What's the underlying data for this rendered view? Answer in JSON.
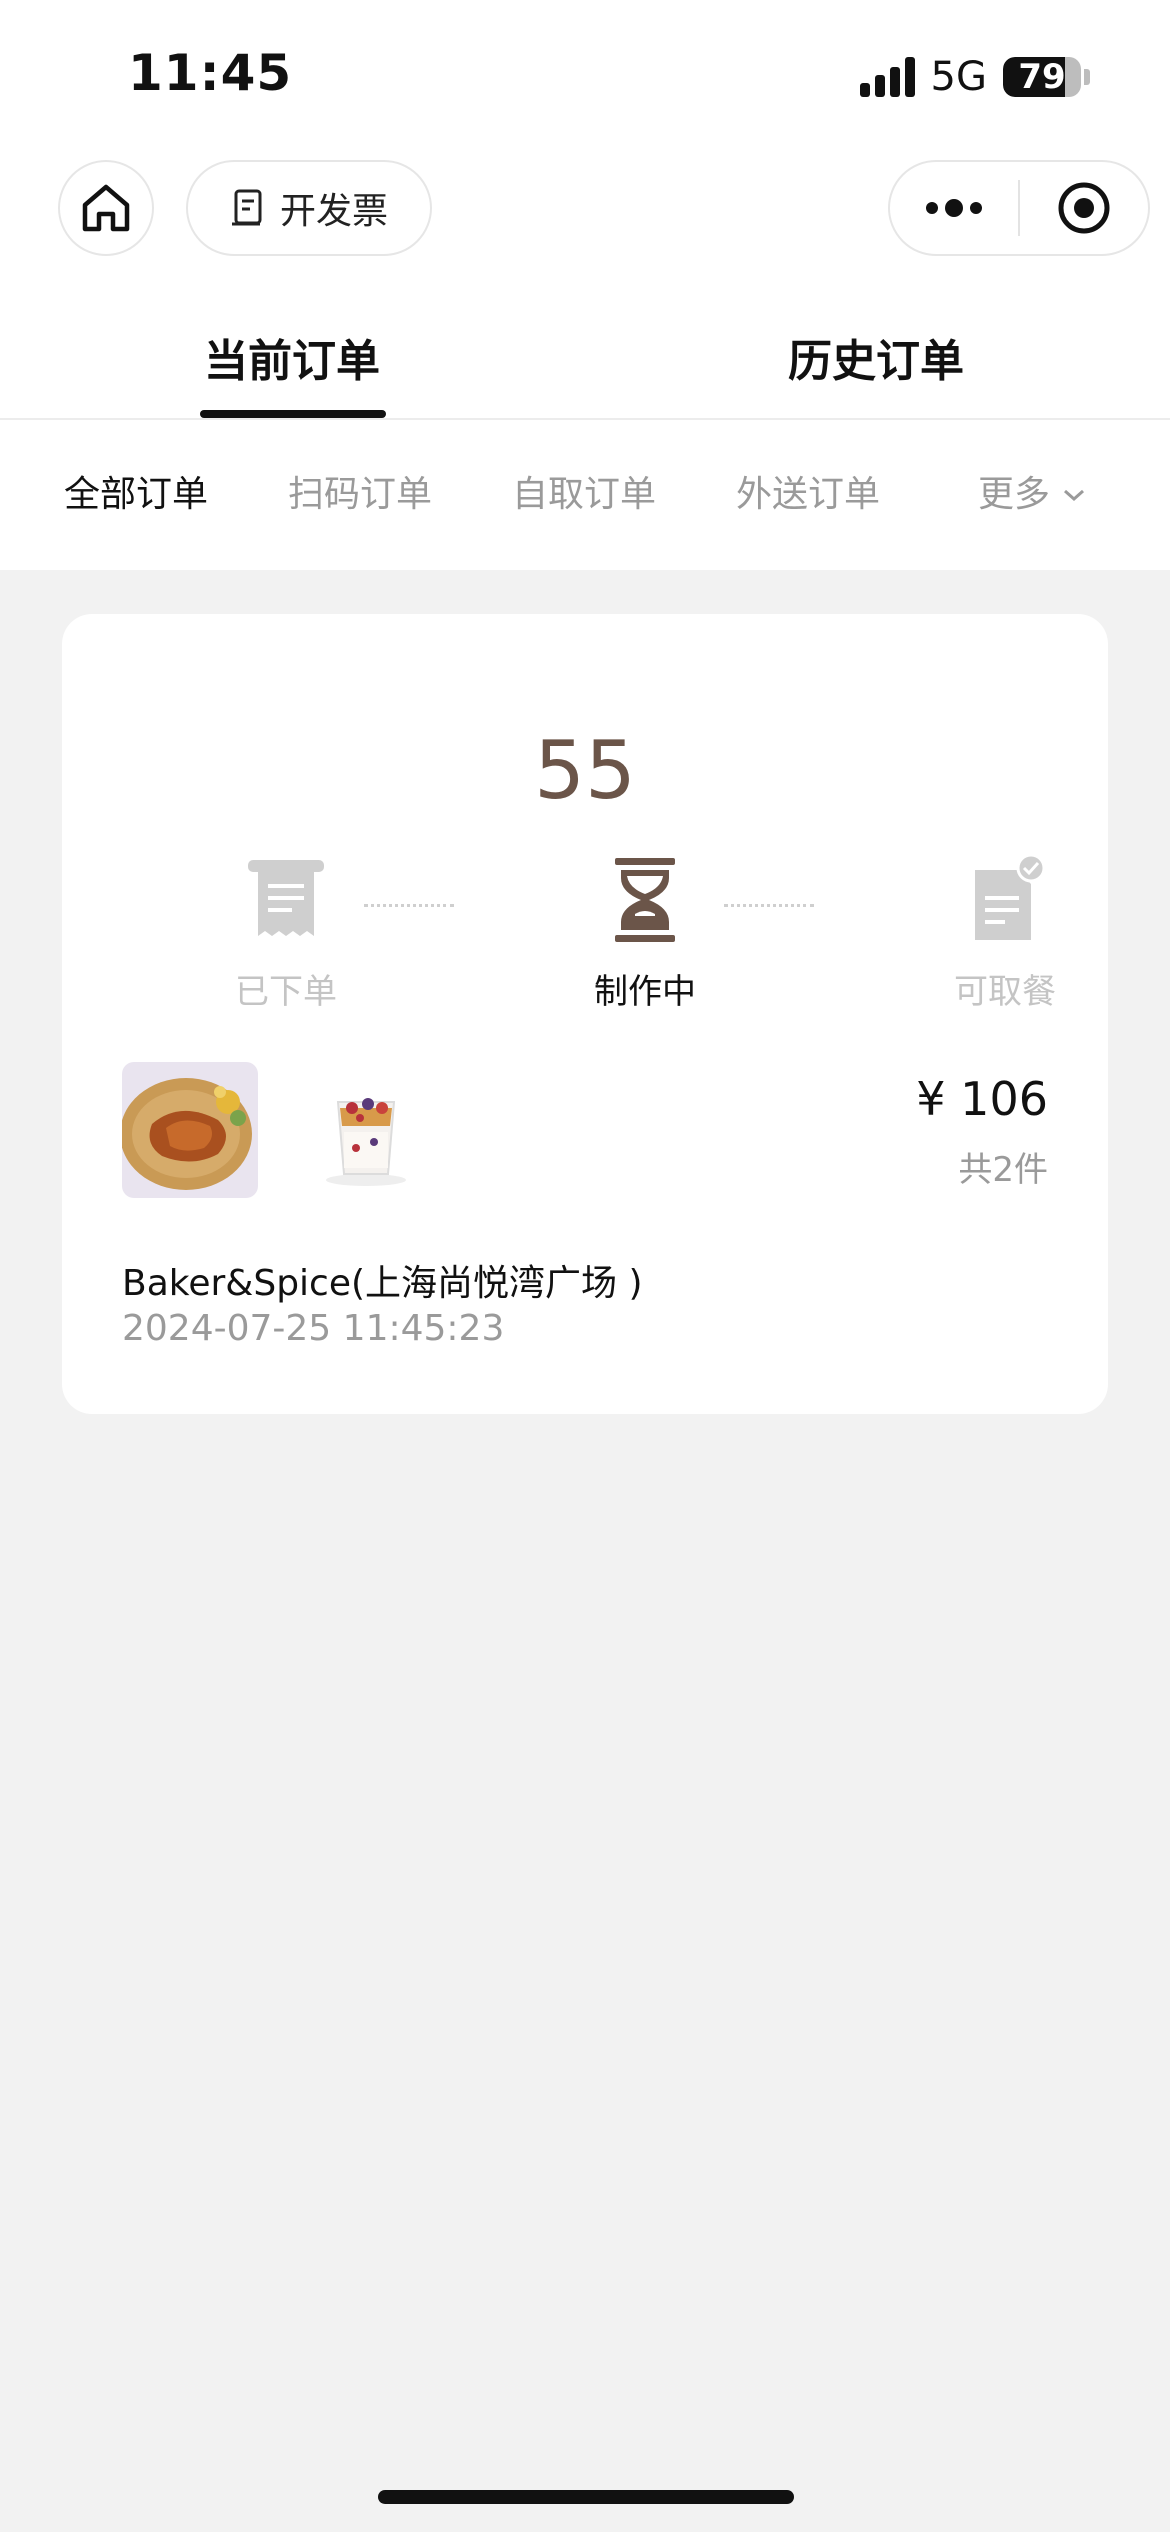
{
  "status_bar": {
    "time": "11:45",
    "network": "5G",
    "battery": "79",
    "battery_level": 0.79
  },
  "nav": {
    "home_icon": "home-icon",
    "invoice_label": "开发票",
    "invoice_icon": "receipt-icon",
    "more_icon": "more-dots-icon",
    "close_icon": "target-close-icon"
  },
  "tabs": [
    {
      "label": "当前订单",
      "active": true
    },
    {
      "label": "历史订单",
      "active": false
    }
  ],
  "filters": [
    {
      "label": "全部订单",
      "active": true
    },
    {
      "label": "扫码订单",
      "active": false
    },
    {
      "label": "自取订单",
      "active": false
    },
    {
      "label": "外送订单",
      "active": false
    },
    {
      "label": "更多",
      "active": false
    }
  ],
  "order": {
    "countdown": "55",
    "steps": [
      {
        "label": "已下单",
        "icon": "receipt-icon",
        "active": false
      },
      {
        "label": "制作中",
        "icon": "hourglass-icon",
        "active": true
      },
      {
        "label": "可取餐",
        "icon": "document-check-icon",
        "active": false
      }
    ],
    "items": [
      {
        "name": "roast-chicken-plate",
        "icon": "food-image"
      },
      {
        "name": "yogurt-parfait",
        "icon": "food-image"
      }
    ],
    "price": "¥ 106",
    "count": "共2件",
    "store": "Baker&Spice(上海尚悦湾广场 )",
    "time": "2024-07-25 11:45:23"
  },
  "colors": {
    "accent": "#6b5549",
    "inactive": "#9a9a9a",
    "background": "#f2f2f2"
  }
}
